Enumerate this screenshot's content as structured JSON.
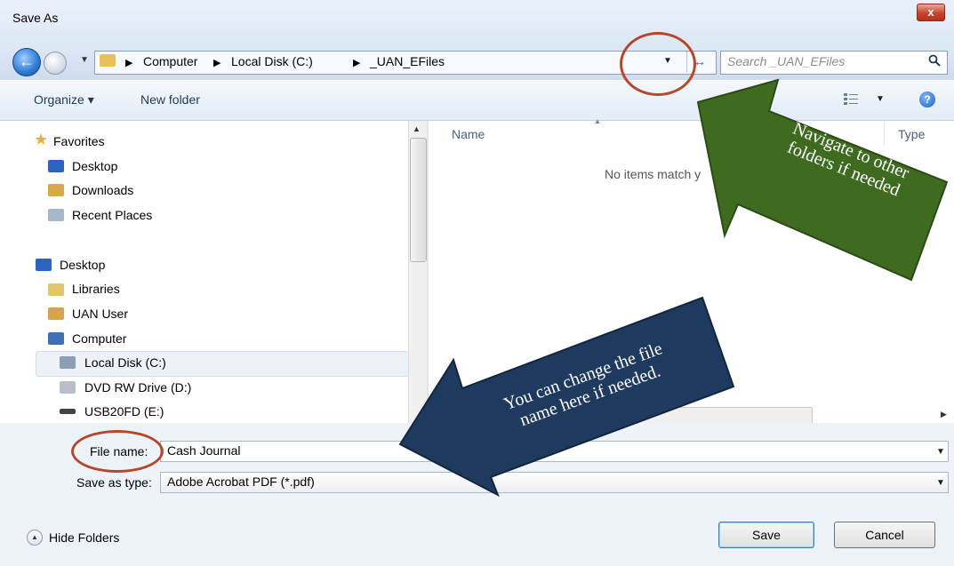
{
  "window": {
    "title": "Save As",
    "close_label": "x"
  },
  "address": {
    "crumbs": [
      "Computer",
      "Local Disk (C:)",
      "_UAN_EFiles"
    ],
    "search_placeholder": "Search _UAN_EFiles"
  },
  "toolbar": {
    "organize": "Organize ▾",
    "new_folder": "New folder"
  },
  "nav": {
    "favorites": "Favorites",
    "fav_items": [
      "Desktop",
      "Downloads",
      "Recent Places"
    ],
    "desktop": "Desktop",
    "items": [
      "Libraries",
      "UAN User",
      "Computer",
      "Local Disk (C:)",
      "DVD RW Drive (D:)",
      "USB20FD (E:)"
    ]
  },
  "filelist": {
    "col_name": "Name",
    "col_type": "Type",
    "empty_msg": "No items match y"
  },
  "form": {
    "file_name_label": "File name:",
    "file_name_value": "Cash Journal",
    "save_type_label": "Save as type:",
    "save_type_value": "Adobe Acrobat PDF (*.pdf)"
  },
  "buttons": {
    "hide_folders": "Hide Folders",
    "save": "Save",
    "cancel": "Cancel"
  },
  "callouts": {
    "green": [
      "Navigate to other",
      "folders if needed"
    ],
    "blue": [
      "You can change the file",
      "name here if needed."
    ]
  },
  "colors": {
    "green_arrow": "#3f6b20",
    "blue_arrow": "#1f3a5f",
    "circle": "#b5472c"
  }
}
